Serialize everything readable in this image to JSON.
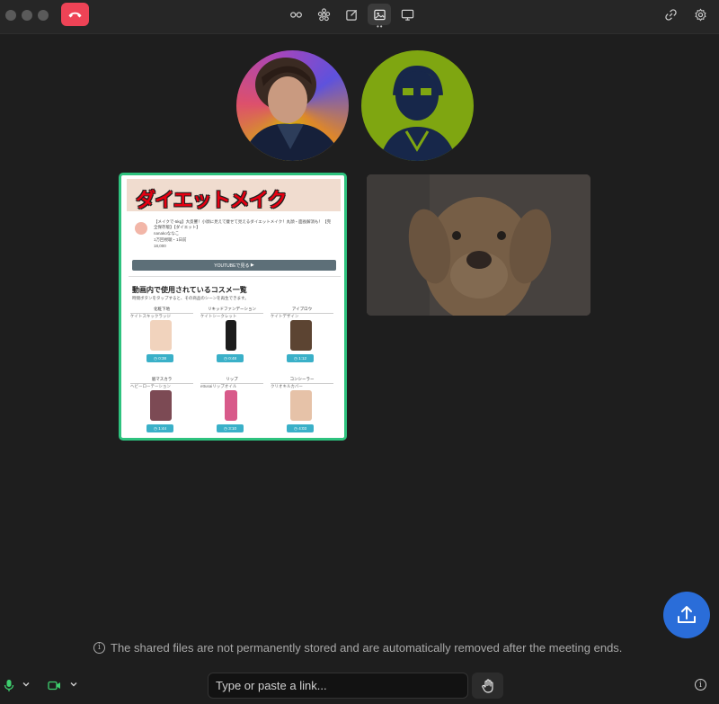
{
  "window": {
    "end_call_icon": "phone-hangup-icon",
    "toolbar_icons": [
      "participants-icon",
      "reactions-icon",
      "whiteboard-icon",
      "image-share-icon",
      "screen-share-icon"
    ],
    "active_tool": "image-share-icon",
    "right_icons": [
      "link-icon",
      "settings-icon"
    ]
  },
  "participants": [
    "participant-avatar-1",
    "participant-avatar-2"
  ],
  "shared_tiles": {
    "youtube_page": {
      "title": "ダイエットメイク",
      "description": "【メイクで-5kg】大反響！小顔に見えて痩せて見えるダイエットメイク！丸顔・面長解消も！【完全保存版】【ダイエット】",
      "channel": "nanakoななこ",
      "meta": "1万回視聴・1日前",
      "likes": "18,000",
      "button_label": "YOUTUBEで見る",
      "section_title": "動画内で使用されているコスメ一覧",
      "section_subtitle": "時間ボタンをタップすると、その商品のシーンを再生できます。",
      "products": [
        {
          "category": "化粧下地",
          "name": "ケイトスキックラッジ",
          "time": "0:38",
          "color": "#f1d3bd"
        },
        {
          "category": "リキッドファンデーション",
          "name": "ケイトシークレット",
          "time": "0:48",
          "color": "#1c1c1c"
        },
        {
          "category": "アイブロウ",
          "name": "ケイトデザイン",
          "time": "1:12",
          "color": "#5c4432"
        },
        {
          "category": "眉マスカラ",
          "name": "ヘビーローテーション",
          "time": "1:44",
          "color": "#7c4a54"
        },
        {
          "category": "リップ",
          "name": "ettusaiリップオイル",
          "time": "3:10",
          "color": "#d85a8a"
        },
        {
          "category": "コンシーラー",
          "name": "クリオキルカバー",
          "time": "4:03",
          "color": "#e6c2a8"
        }
      ]
    },
    "dog_photo": {
      "alt": "puppy-photo"
    }
  },
  "upload_fab_icon": "upload-icon",
  "notice": {
    "icon": "info-icon",
    "text": "The shared files are not permanently stored and are automatically removed after the meeting ends."
  },
  "bottom": {
    "link_input": {
      "placeholder": "Type or paste a link...",
      "value": ""
    },
    "mic_icon": "microphone-icon",
    "camera_icon": "camera-icon",
    "raise_hand_icon": "raise-hand-icon",
    "info_icon": "info-icon"
  },
  "colors": {
    "accent": "#2a6dd9",
    "end_call": "#ee4356",
    "active_border": "#2ec27e",
    "mic": "#3ecf6e"
  }
}
